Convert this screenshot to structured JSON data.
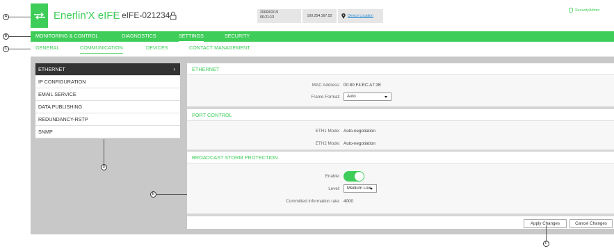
{
  "header": {
    "app_name": "Enerlin'X eIFE",
    "device_name": "eIFE-021234",
    "date": "2000/02/19",
    "time": "06:21:13",
    "ip": "169.254.167.52",
    "device_location": "Device Location",
    "user": "SecurityAdmin"
  },
  "menu": {
    "items": [
      {
        "label": "MONITORING & CONTROL"
      },
      {
        "label": "DIAGNOSTICS"
      },
      {
        "label": "SETTINGS"
      },
      {
        "label": "SECURITY"
      }
    ],
    "active": "SETTINGS"
  },
  "subtabs": {
    "items": [
      {
        "label": "GENERAL"
      },
      {
        "label": "COMMUNICATION"
      },
      {
        "label": "DEVICES"
      },
      {
        "label": "CONTACT MANAGEMENT"
      }
    ],
    "active": "COMMUNICATION"
  },
  "leftnav": {
    "items": [
      {
        "label": "ETHERNET"
      },
      {
        "label": "IP CONFIGURATION"
      },
      {
        "label": "EMAIL SERVICE"
      },
      {
        "label": "DATA PUBLISHING"
      },
      {
        "label": "REDUNDANCY-RSTP"
      },
      {
        "label": "SNMP"
      }
    ],
    "active": "ETHERNET",
    "active_chevron": "›"
  },
  "ethernet": {
    "title": "ETHERNET",
    "mac_label": "MAC Address:",
    "mac_value": "00:80:F4:EC:A7:3E",
    "frame_label": "Frame Format:",
    "frame_value": "Auto"
  },
  "port_control": {
    "title": "PORT CONTROL",
    "eth1_label": "ETH1 Mode:",
    "eth1_value": "Auto-negotiation",
    "eth2_label": "ETH2 Mode:",
    "eth2_value": "Auto-negotiation"
  },
  "storm": {
    "title": "BROADCAST STORM PROTECTION",
    "enable_label": "Enable:",
    "enabled": true,
    "level_label": "Level:",
    "level_value": "Medium Low",
    "rate_label": "Committed information rate:",
    "rate_value": "4000"
  },
  "footer": {
    "apply_label": "Apply Changes",
    "cancel_label": "Cancel Changes"
  },
  "callouts": {
    "a": "A",
    "b": "B",
    "c": "C",
    "d": "D",
    "e": "E",
    "f": "F"
  },
  "icons": {
    "logo": "arrows-exchange-icon",
    "lock": "lock-icon",
    "location": "location-pin-icon",
    "user": "user-shield-icon"
  },
  "colors": {
    "accent": "#3dcd58",
    "active_nav": "#333333",
    "content_bg": "#c8c8c8",
    "link": "#2b8bd1"
  }
}
